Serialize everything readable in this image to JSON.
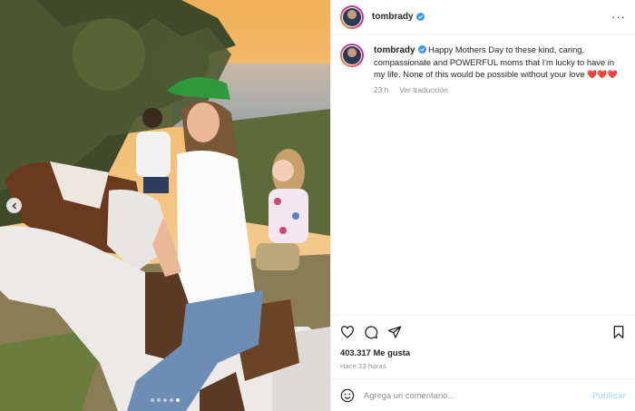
{
  "post": {
    "username": "tombrady",
    "caption": "Happy Mothers Day to these kind, caring, compassionate and POWERFUL moms that I'm lucky to have in my life. None of this would be possible without your love",
    "hearts": "❤️❤️❤️",
    "caption_age": "23 h",
    "translate_label": "Ver traducción",
    "likes": "403.317 Me gusta",
    "time_ago": "Hace 23 horas",
    "carousel_count": 5,
    "carousel_active": 4
  },
  "comment": {
    "placeholder": "Agrega un comentario...",
    "publish_label": "Publicar"
  },
  "icons": {
    "verified": "verified-badge-icon",
    "more": "more-options-icon",
    "like": "heart-icon",
    "comment": "comment-icon",
    "share": "share-icon",
    "save": "bookmark-icon",
    "emoji": "emoji-icon",
    "prev": "chevron-left-icon"
  },
  "colors": {
    "verified_blue": "#3897f0",
    "publish_disabled": "#b2dffc",
    "heart_red": "#e0243c"
  }
}
